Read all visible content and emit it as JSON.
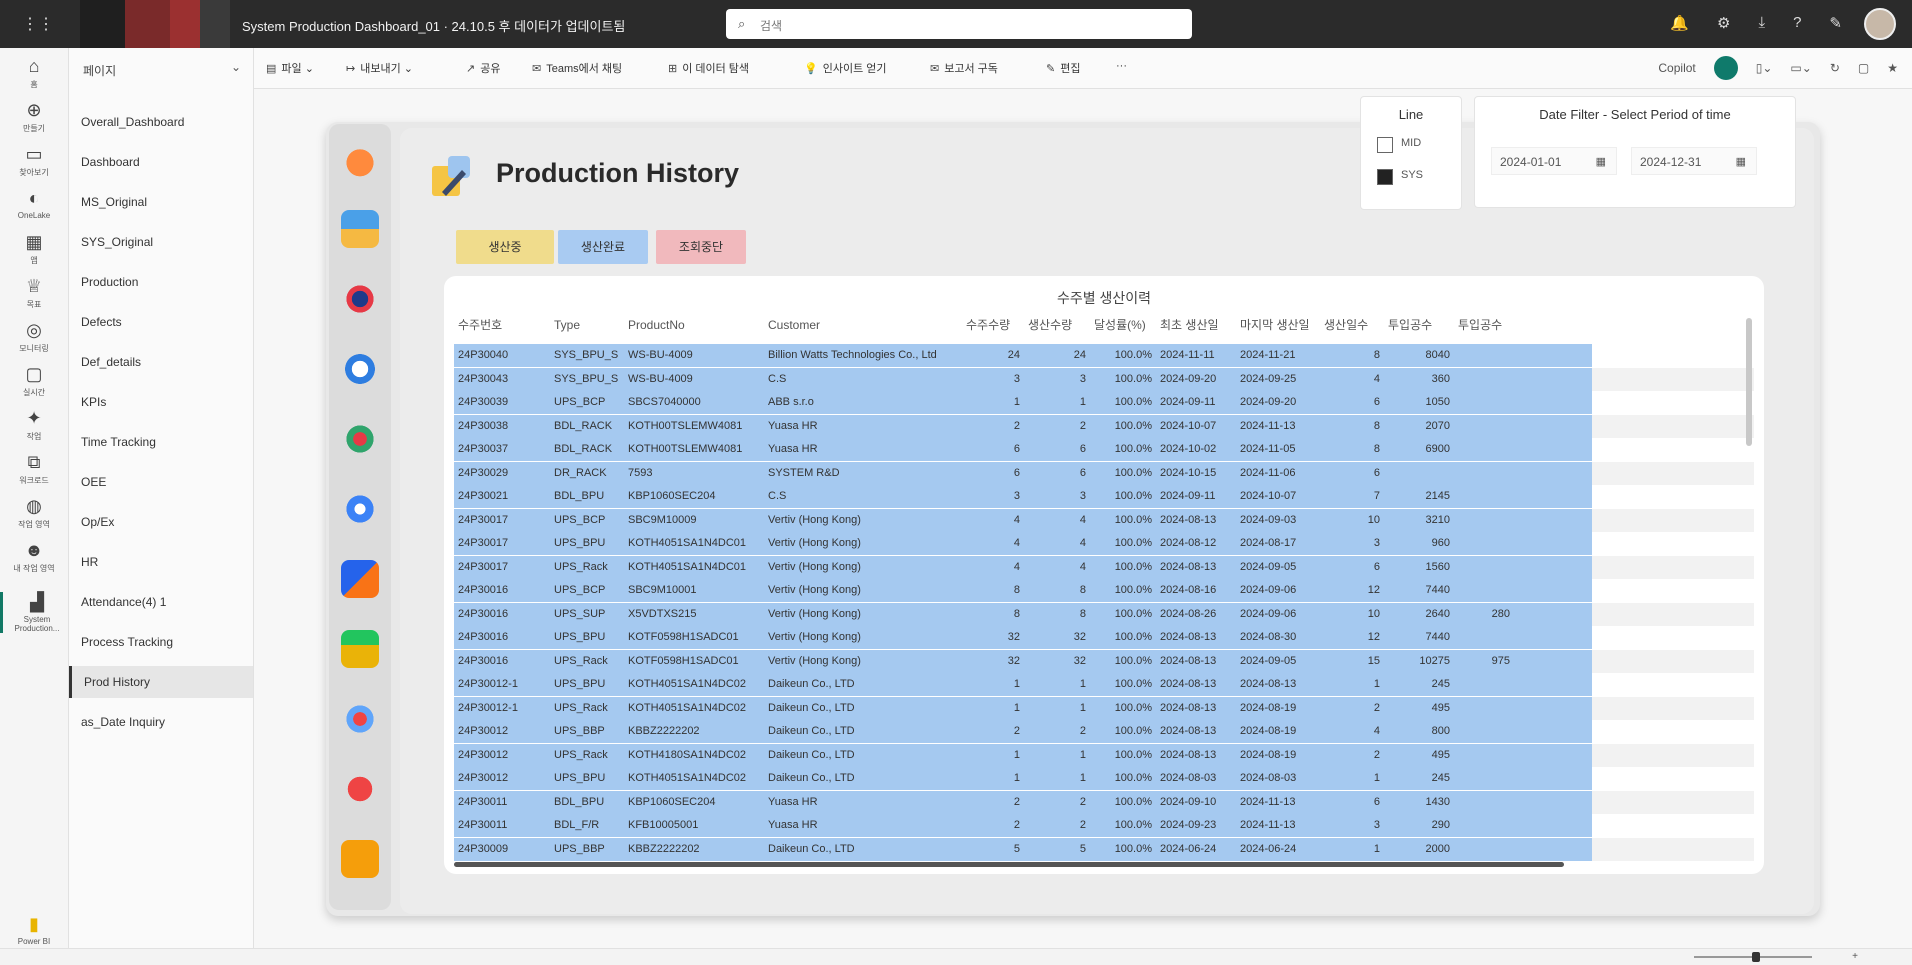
{
  "topbar": {
    "title": "System Production Dashboard_01 · 24.10.5 후 데이터가 업데이트됨",
    "search_placeholder": "검색"
  },
  "rail": {
    "items": [
      "홈",
      "만들기",
      "찾아보기",
      "OneLake",
      "앱",
      "목표",
      "모니터링",
      "실시간",
      "작업",
      "워크로드",
      "작업 영역",
      "내 작업 영역",
      "System Production..."
    ],
    "bottom": "Power BI"
  },
  "nav": {
    "header": "페이지",
    "pages": [
      "Overall_Dashboard",
      "Dashboard",
      "MS_Original",
      "SYS_Original",
      "Production",
      "Defects",
      "Def_details",
      "KPIs",
      "Time Tracking",
      "OEE",
      "Op/Ex",
      "HR",
      "Attendance(4) 1",
      "Process Tracking",
      "Prod History",
      "as_Date Inquiry"
    ],
    "active_index": 14
  },
  "toolbar": {
    "items": [
      "파일",
      "내보내기",
      "공유",
      "Teams에서 채팅",
      "이 데이터 탐색",
      "인사이트 얻기",
      "보고서 구독",
      "편집",
      "···"
    ],
    "copilot": "Copilot"
  },
  "report": {
    "title": "Production History",
    "buttons": [
      "생산중",
      "생산완료",
      "조회중단"
    ],
    "button_colors": [
      "#f0dc8c",
      "#a9cbf2",
      "#f1b9bd"
    ]
  },
  "line_slicer": {
    "title": "Line",
    "options": [
      {
        "label": "MID",
        "checked": false
      },
      {
        "label": "SYS",
        "checked": true
      }
    ]
  },
  "date_slicer": {
    "title": "Date Filter - Select Period of time",
    "start": "2024-01-01",
    "end": "2024-12-31"
  },
  "table": {
    "title": "수주별 생산이력",
    "columns": [
      "수주번호",
      "Type",
      "ProductNo",
      "Customer",
      "수주수량",
      "생산수량",
      "달성률(%)",
      "최초 생산일",
      "마지막 생산일",
      "생산일수",
      "투입공수",
      "투입공수"
    ],
    "rows": [
      [
        "24P30040",
        "SYS_BPU_S",
        "WS-BU-4009",
        "Billion Watts Technologies Co., Ltd",
        "24",
        "24",
        "100.0%",
        "2024-11-11",
        "2024-11-21",
        "8",
        "8040",
        ""
      ],
      [
        "24P30043",
        "SYS_BPU_S",
        "WS-BU-4009",
        "C.S",
        "3",
        "3",
        "100.0%",
        "2024-09-20",
        "2024-09-25",
        "4",
        "360",
        ""
      ],
      [
        "24P30039",
        "UPS_BCP",
        "SBCS7040000",
        "ABB s.r.o",
        "1",
        "1",
        "100.0%",
        "2024-09-11",
        "2024-09-20",
        "6",
        "1050",
        ""
      ],
      [
        "24P30038",
        "BDL_RACK",
        "KOTH00TSLEMW4081",
        "Yuasa HR",
        "2",
        "2",
        "100.0%",
        "2024-10-07",
        "2024-11-13",
        "8",
        "2070",
        ""
      ],
      [
        "24P30037",
        "BDL_RACK",
        "KOTH00TSLEMW4081",
        "Yuasa HR",
        "6",
        "6",
        "100.0%",
        "2024-10-02",
        "2024-11-05",
        "8",
        "6900",
        ""
      ],
      [
        "24P30029",
        "DR_RACK",
        "7593",
        "SYSTEM R&D",
        "6",
        "6",
        "100.0%",
        "2024-10-15",
        "2024-11-06",
        "6",
        "",
        ""
      ],
      [
        "24P30021",
        "BDL_BPU",
        "KBP1060SEC204",
        "C.S",
        "3",
        "3",
        "100.0%",
        "2024-09-11",
        "2024-10-07",
        "7",
        "2145",
        ""
      ],
      [
        "24P30017",
        "UPS_BCP",
        "SBC9M10009",
        "Vertiv (Hong Kong)",
        "4",
        "4",
        "100.0%",
        "2024-08-13",
        "2024-09-03",
        "10",
        "3210",
        ""
      ],
      [
        "24P30017",
        "UPS_BPU",
        "KOTH4051SA1N4DC01",
        "Vertiv (Hong Kong)",
        "4",
        "4",
        "100.0%",
        "2024-08-12",
        "2024-08-17",
        "3",
        "960",
        ""
      ],
      [
        "24P30017",
        "UPS_Rack",
        "KOTH4051SA1N4DC01",
        "Vertiv (Hong Kong)",
        "4",
        "4",
        "100.0%",
        "2024-08-13",
        "2024-09-05",
        "6",
        "1560",
        ""
      ],
      [
        "24P30016",
        "UPS_BCP",
        "SBC9M10001",
        "Vertiv (Hong Kong)",
        "8",
        "8",
        "100.0%",
        "2024-08-16",
        "2024-09-06",
        "12",
        "7440",
        ""
      ],
      [
        "24P30016",
        "UPS_SUP",
        "X5VDTXS215",
        "Vertiv (Hong Kong)",
        "8",
        "8",
        "100.0%",
        "2024-08-26",
        "2024-09-06",
        "10",
        "2640",
        "280"
      ],
      [
        "24P30016",
        "UPS_BPU",
        "KOTF0598H1SADC01",
        "Vertiv (Hong Kong)",
        "32",
        "32",
        "100.0%",
        "2024-08-13",
        "2024-08-30",
        "12",
        "7440",
        ""
      ],
      [
        "24P30016",
        "UPS_Rack",
        "KOTF0598H1SADC01",
        "Vertiv (Hong Kong)",
        "32",
        "32",
        "100.0%",
        "2024-08-13",
        "2024-09-05",
        "15",
        "10275",
        "975"
      ],
      [
        "24P30012-1",
        "UPS_BPU",
        "KOTH4051SA1N4DC02",
        "Daikeun Co., LTD",
        "1",
        "1",
        "100.0%",
        "2024-08-13",
        "2024-08-13",
        "1",
        "245",
        ""
      ],
      [
        "24P30012-1",
        "UPS_Rack",
        "KOTH4051SA1N4DC02",
        "Daikeun Co., LTD",
        "1",
        "1",
        "100.0%",
        "2024-08-13",
        "2024-08-19",
        "2",
        "495",
        ""
      ],
      [
        "24P30012",
        "UPS_BBP",
        "KBBZ2222202",
        "Daikeun Co., LTD",
        "2",
        "2",
        "100.0%",
        "2024-08-13",
        "2024-08-19",
        "4",
        "800",
        ""
      ],
      [
        "24P30012",
        "UPS_Rack",
        "KOTH4180SA1N4DC02",
        "Daikeun Co., LTD",
        "1",
        "1",
        "100.0%",
        "2024-08-13",
        "2024-08-19",
        "2",
        "495",
        ""
      ],
      [
        "24P30012",
        "UPS_BPU",
        "KOTH4051SA1N4DC02",
        "Daikeun Co., LTD",
        "1",
        "1",
        "100.0%",
        "2024-08-03",
        "2024-08-03",
        "1",
        "245",
        ""
      ],
      [
        "24P30011",
        "BDL_BPU",
        "KBP1060SEC204",
        "Yuasa HR",
        "2",
        "2",
        "100.0%",
        "2024-09-10",
        "2024-11-13",
        "6",
        "1430",
        ""
      ],
      [
        "24P30011",
        "BDL_F/R",
        "KFB10005001",
        "Yuasa HR",
        "2",
        "2",
        "100.0%",
        "2024-09-23",
        "2024-11-13",
        "3",
        "290",
        ""
      ],
      [
        "24P30009",
        "UPS_BBP",
        "KBBZ2222202",
        "Daikeun Co., LTD",
        "5",
        "5",
        "100.0%",
        "2024-06-24",
        "2024-06-24",
        "1",
        "2000",
        ""
      ]
    ]
  }
}
